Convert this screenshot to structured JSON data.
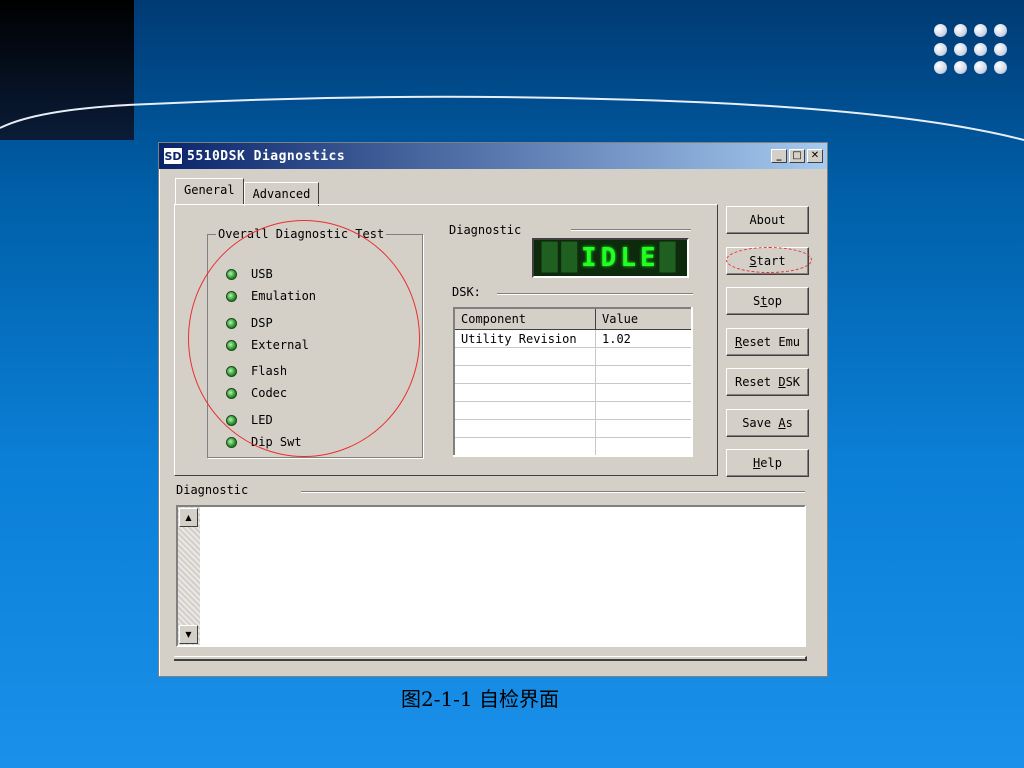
{
  "window": {
    "title": "5510DSK Diagnostics",
    "app_icon_label": "SD",
    "minimize_glyph": "_",
    "maximize_glyph": "□",
    "close_glyph": "✕"
  },
  "tabs": [
    {
      "label": "General",
      "active": true
    },
    {
      "label": "Advanced",
      "active": false
    }
  ],
  "overall_test": {
    "legend": "Overall Diagnostic Test",
    "items": [
      "USB",
      "Emulation",
      "DSP",
      "External",
      "Flash",
      "Codec",
      "LED",
      "Dip Swt"
    ]
  },
  "diagnostic_display": {
    "label": "Diagnostic",
    "status": "IDLE"
  },
  "dsk": {
    "label": "DSK:",
    "columns": [
      "Component",
      "Value"
    ],
    "rows": [
      [
        "Utility Revision",
        "1.02"
      ]
    ]
  },
  "buttons": {
    "about": {
      "pre": "",
      "key": "",
      "post": "About"
    },
    "start": {
      "pre": "",
      "key": "S",
      "post": "tart"
    },
    "stop": {
      "pre": "S",
      "key": "t",
      "post": "op"
    },
    "reset_emu": {
      "pre": "",
      "key": "R",
      "post": "eset Emu"
    },
    "reset_dsk": {
      "pre": "Reset ",
      "key": "D",
      "post": "SK"
    },
    "save_as": {
      "pre": "Save ",
      "key": "A",
      "post": "s"
    },
    "help": {
      "pre": "",
      "key": "H",
      "post": "elp"
    }
  },
  "output": {
    "label": "Diagnostic",
    "text": ""
  },
  "caption": "图2-1-1 自检界面",
  "colors": {
    "title_bar_start": "#0a246a",
    "title_bar_end": "#a6caf0",
    "window_face": "#d4d0c8",
    "lcd_text": "#22ff22",
    "annotation": "#e83030"
  }
}
